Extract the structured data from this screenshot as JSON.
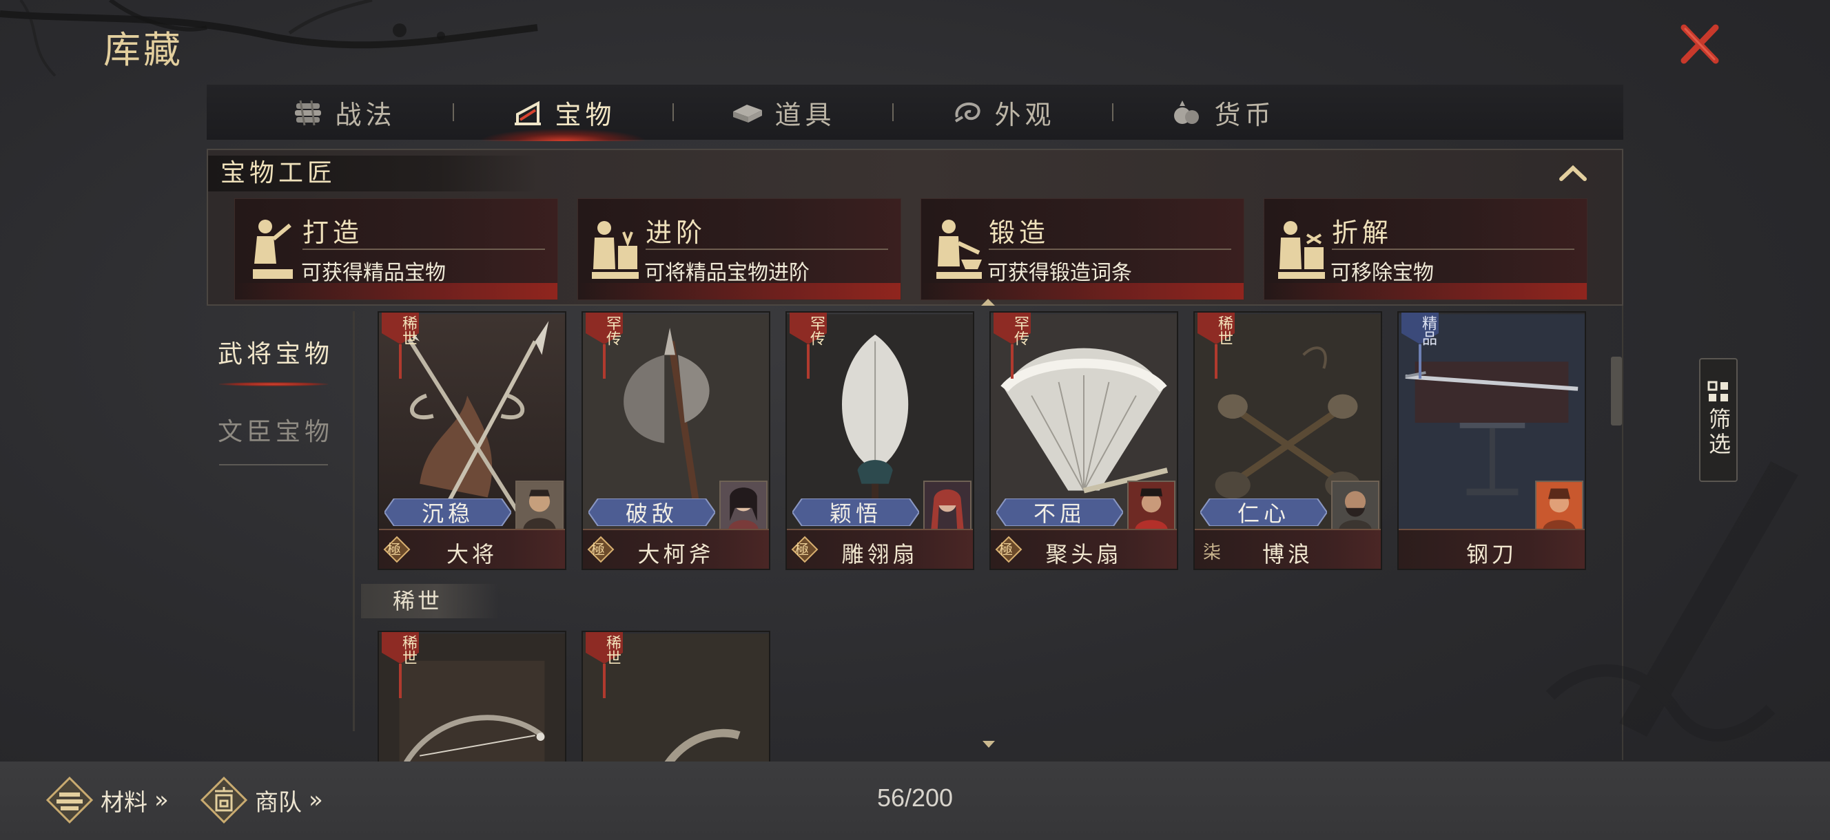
{
  "page": {
    "title": "库藏"
  },
  "tabs": [
    {
      "label": "战法",
      "icon": "scroll-bundle-icon",
      "active": false
    },
    {
      "label": "宝物",
      "icon": "treasure-stand-icon",
      "active": true
    },
    {
      "label": "道具",
      "icon": "ingot-icon",
      "active": false
    },
    {
      "label": "外观",
      "icon": "swirl-icon",
      "active": false
    },
    {
      "label": "货币",
      "icon": "money-bag-icon",
      "active": false
    }
  ],
  "craftsman": {
    "title": "宝物工匠",
    "cards": [
      {
        "title": "打造",
        "desc": "可获得精品宝物",
        "icon": "blacksmith-icon"
      },
      {
        "title": "进阶",
        "desc": "可将精品宝物进阶",
        "icon": "blacksmith-upgrade-icon"
      },
      {
        "title": "锻造",
        "desc": "可获得锻造词条",
        "icon": "anvil-forge-icon"
      },
      {
        "title": "折解",
        "desc": "可移除宝物",
        "icon": "dismantle-icon"
      }
    ]
  },
  "side_tabs": [
    {
      "label": "武将宝物",
      "active": true
    },
    {
      "label": "文臣宝物",
      "active": false
    }
  ],
  "items_row1": [
    {
      "name": "大将",
      "rarity": "稀世",
      "trait": "沉稳",
      "grade": "極",
      "art": "twin-halberd"
    },
    {
      "name": "大柯斧",
      "rarity": "罕传",
      "trait": "破敌",
      "grade": "極",
      "art": "axe"
    },
    {
      "name": "雕翎扇",
      "rarity": "罕传",
      "trait": "颖悟",
      "grade": "極",
      "art": "feather-fan"
    },
    {
      "name": "聚头扇",
      "rarity": "罕传",
      "trait": "不屈",
      "grade": "極",
      "art": "folding-fan"
    },
    {
      "name": "博浪",
      "rarity": "稀世",
      "trait": "仁心",
      "grade": "柒",
      "art": "hammers"
    },
    {
      "name": "钢刀",
      "rarity": "精品",
      "trait": "",
      "grade": "",
      "art": "blade"
    }
  ],
  "section": {
    "label": "稀世"
  },
  "items_row2": [
    {
      "rarity": "稀世",
      "art": "bow"
    },
    {
      "rarity": "稀世",
      "art": "dagger"
    }
  ],
  "filter": {
    "label": "筛选"
  },
  "bottom": {
    "materials": "材料",
    "caravan": "商队",
    "arrows": "»",
    "capacity": "56/200"
  },
  "colors": {
    "accent_gold": "#e3cf9e",
    "close_red": "#c8392b",
    "active_glow": "#d8432f",
    "trait_blue": "#5a6ca0"
  }
}
